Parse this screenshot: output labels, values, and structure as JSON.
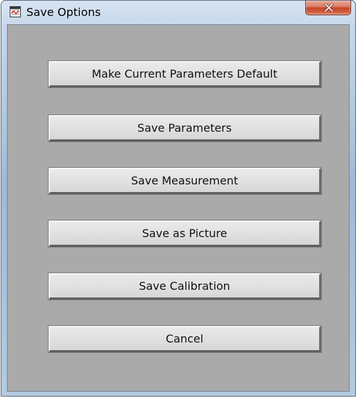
{
  "window": {
    "title": "Save Options",
    "title_icon": "graph-window-icon",
    "close_icon": "close-icon"
  },
  "buttons": [
    {
      "label": "Make Current Parameters Default"
    },
    {
      "label": "Save Parameters"
    },
    {
      "label": "Save Measurement"
    },
    {
      "label": "Save as Picture"
    },
    {
      "label": "Save Calibration"
    },
    {
      "label": "Cancel"
    }
  ],
  "colors": {
    "panel_background": "#aaaaaa",
    "button_face": "#e2e2e2",
    "close_button": "#c7462b"
  }
}
